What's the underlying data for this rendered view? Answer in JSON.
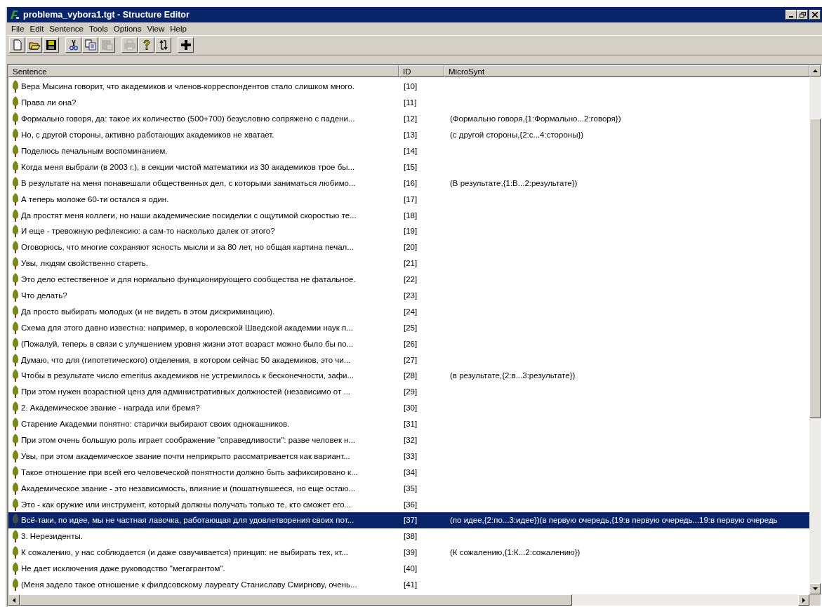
{
  "window": {
    "title": "problema_vybora1.tgt - Structure Editor"
  },
  "menu": [
    "File",
    "Edit",
    "Sentence",
    "Tools",
    "Options",
    "View",
    "Help"
  ],
  "toolbar": [
    {
      "kind": "new",
      "disabled": false
    },
    {
      "kind": "open",
      "disabled": false
    },
    {
      "kind": "save",
      "disabled": false
    },
    {
      "kind": "sep"
    },
    {
      "kind": "cut",
      "disabled": false
    },
    {
      "kind": "copy",
      "disabled": false
    },
    {
      "kind": "paste",
      "disabled": true
    },
    {
      "kind": "sep"
    },
    {
      "kind": "print",
      "disabled": true
    },
    {
      "kind": "help",
      "disabled": false
    },
    {
      "kind": "swap",
      "disabled": false
    },
    {
      "kind": "sep"
    },
    {
      "kind": "plus",
      "disabled": false
    }
  ],
  "table": {
    "columns": [
      "Sentence",
      "ID",
      "MicroSynt"
    ],
    "rows": [
      {
        "sentence": "Вера Мысина говорит, что академиков и членов-корреспондентов стало слишком много.",
        "id": "[10]",
        "microsynt": "",
        "selected": false
      },
      {
        "sentence": "Права ли она?",
        "id": "[11]",
        "microsynt": "",
        "selected": false
      },
      {
        "sentence": "Формально говоря, да: такое их количество (500+700) безусловно сопряжено с падени...",
        "id": "[12]",
        "microsynt": "(Формально говоря,{1:Формально...2:говоря})",
        "selected": false
      },
      {
        "sentence": "Но, с другой стороны, активно работающих академиков не хватает.",
        "id": "[13]",
        "microsynt": "(с другой стороны,{2:с...4:стороны})",
        "selected": false
      },
      {
        "sentence": "Поделюсь печальным воспоминанием.",
        "id": "[14]",
        "microsynt": "",
        "selected": false
      },
      {
        "sentence": "Когда меня выбрали (в 2003 г.), в секции чистой математики из 30 академиков трое бы...",
        "id": "[15]",
        "microsynt": "",
        "selected": false
      },
      {
        "sentence": "В результате на меня понавешали общественных дел, с которыми заниматься любимо...",
        "id": "[16]",
        "microsynt": "(В результате,{1:В...2:результате})",
        "selected": false
      },
      {
        "sentence": "А теперь моложе 60-ти остался я один.",
        "id": "[17]",
        "microsynt": "",
        "selected": false
      },
      {
        "sentence": "Да простят меня коллеги, но наши академические посиделки с ощутимой скоростью те...",
        "id": "[18]",
        "microsynt": "",
        "selected": false
      },
      {
        "sentence": "И еще - тревожную рефлексию: а сам-то насколько далек от этого?",
        "id": "[19]",
        "microsynt": "",
        "selected": false
      },
      {
        "sentence": "Оговорюсь, что многие сохраняют ясность мысли и за 80 лет, но общая картина печал...",
        "id": "[20]",
        "microsynt": "",
        "selected": false
      },
      {
        "sentence": "Увы, людям свойственно стареть.",
        "id": "[21]",
        "microsynt": "",
        "selected": false
      },
      {
        "sentence": "Это дело естественное и для нормально функционирующего сообщества не фатальное.",
        "id": "[22]",
        "microsynt": "",
        "selected": false
      },
      {
        "sentence": "Что делать?",
        "id": "[23]",
        "microsynt": "",
        "selected": false
      },
      {
        "sentence": "Да просто выбирать молодых (и не видеть в этом дискриминацию).",
        "id": "[24]",
        "microsynt": "",
        "selected": false
      },
      {
        "sentence": "Схема для этого давно известна: например, в королевской Шведской академии наук п...",
        "id": "[25]",
        "microsynt": "",
        "selected": false
      },
      {
        "sentence": "(Пожалуй, теперь в связи с улучшением уровня жизни этот возраст можно было бы по...",
        "id": "[26]",
        "microsynt": "",
        "selected": false
      },
      {
        "sentence": "Думаю, что для (гипотетического) отделения, в котором сейчас 50 академиков, это чи...",
        "id": "[27]",
        "microsynt": "",
        "selected": false
      },
      {
        "sentence": "Чтобы в результате число emeritus академиков не устремилось к бесконечности, зафи...",
        "id": "[28]",
        "microsynt": "(в результате,{2:в...3:результате})",
        "selected": false
      },
      {
        "sentence": "При этом нужен возрастной ценз для административных должностей (независимо от ...",
        "id": "[29]",
        "microsynt": "",
        "selected": false
      },
      {
        "sentence": "2. Академическое звание - награда или бремя?",
        "id": "[30]",
        "microsynt": "",
        "selected": false
      },
      {
        "sentence": "Старение Академии понятно: старички выбирают своих однокашников.",
        "id": "[31]",
        "microsynt": "",
        "selected": false
      },
      {
        "sentence": "При этом очень большую роль играет соображение \"справедливости\": разве человек н...",
        "id": "[32]",
        "microsynt": "",
        "selected": false
      },
      {
        "sentence": "Увы, при этом академическое звание почти неприкрыто рассматривается как вариант...",
        "id": "[33]",
        "microsynt": "",
        "selected": false
      },
      {
        "sentence": "Такое отношение при всей его человеческой понятности должно быть зафиксировано к...",
        "id": "[34]",
        "microsynt": "",
        "selected": false
      },
      {
        "sentence": "Академическое звание - это независимость, влияние и (пошатнувшееся, но еще остаю...",
        "id": "[35]",
        "microsynt": "",
        "selected": false
      },
      {
        "sentence": "Это - как оружие или инструмент, который должны получать только те, кто сможет его...",
        "id": "[36]",
        "microsynt": "",
        "selected": false
      },
      {
        "sentence": "Всё-таки, по идее, мы не частная лавочка, работающая для удовлетворения своих пот...",
        "id": "[37]",
        "microsynt": "(по идее,{2:по...3:идее})(в первую очередь,{19:в первую очередь...19:в первую очередь",
        "selected": true
      },
      {
        "sentence": "3. Нерезиденты.",
        "id": "[38]",
        "microsynt": "",
        "selected": false
      },
      {
        "sentence": "К сожалению, у нас соблюдается (и даже озвучивается) принцип: не выбирать тех, кт...",
        "id": "[39]",
        "microsynt": "(К сожалению,{1:К...2:сожалению})",
        "selected": false
      },
      {
        "sentence": "Не дает исключения даже руководство \"мегагрантом\".",
        "id": "[40]",
        "microsynt": "",
        "selected": false
      },
      {
        "sentence": "(Меня задело такое отношение к филдсовскому лауреату Станиславу Смирнову, очень...",
        "id": "[41]",
        "microsynt": "",
        "selected": false
      }
    ]
  }
}
